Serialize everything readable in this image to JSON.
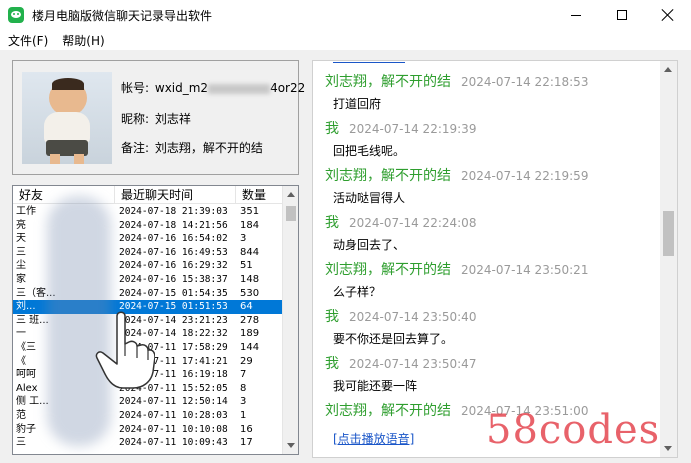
{
  "window": {
    "title": "楼月电脑版微信聊天记录导出软件",
    "controls": [
      "minimize",
      "maximize",
      "close"
    ]
  },
  "menu": [
    "文件(F)",
    "帮助(H)"
  ],
  "profile": {
    "account_label": "帐号:",
    "account_prefix": "wxid_m2",
    "account_suffix": "4or22",
    "nickname_label": "昵称:",
    "nickname": "刘志祥",
    "note_label": "备注:",
    "note": "刘志翔，解不开的结"
  },
  "friends": {
    "headers": [
      "好友",
      "最近聊天时间",
      "数量"
    ],
    "rows": [
      {
        "name": "工作",
        "time": "2024-07-18 21:39:03",
        "count": "351"
      },
      {
        "name": "亮",
        "time": "2024-07-18 14:21:56",
        "count": "184"
      },
      {
        "name": "天",
        "time": "2024-07-16 16:54:02",
        "count": "3"
      },
      {
        "name": "三",
        "time": "2024-07-16 16:49:53",
        "count": "844"
      },
      {
        "name": "尘",
        "time": "2024-07-16 16:29:32",
        "count": "51"
      },
      {
        "name": "家",
        "time": "2024-07-16 15:38:37",
        "count": "148"
      },
      {
        "name": "三（客...",
        "time": "2024-07-15 01:54:35",
        "count": "530"
      },
      {
        "name": "刘...",
        "time": "2024-07-15 01:51:53",
        "count": "64",
        "selected": true
      },
      {
        "name": "三 班...",
        "time": "2024-07-14 23:21:23",
        "count": "278"
      },
      {
        "name": "一",
        "time": "2024-07-14 18:22:32",
        "count": "189"
      },
      {
        "name": "《三",
        "time": "2024-07-11 17:58:29",
        "count": "144"
      },
      {
        "name": "《",
        "time": "2024-07-11 17:41:21",
        "count": "29"
      },
      {
        "name": "呵呵",
        "time": "2024-07-11 16:19:18",
        "count": "7"
      },
      {
        "name": "Alex",
        "time": "2024-07-11 15:52:05",
        "count": "8"
      },
      {
        "name": "侧 工...",
        "time": "2024-07-11 12:50:14",
        "count": "3"
      },
      {
        "name": "范",
        "time": "2024-07-11 10:28:03",
        "count": "1"
      },
      {
        "name": "豹子",
        "time": "2024-07-11 10:10:08",
        "count": "16"
      },
      {
        "name": "三",
        "time": "2024-07-11 10:09:43",
        "count": "17"
      }
    ]
  },
  "chat": {
    "messages": [
      {
        "sender": "刘志翔，解不开的结",
        "time": "2024-07-14 22:18:53",
        "text": "打道回府"
      },
      {
        "sender": "我",
        "time": "2024-07-14 22:19:39",
        "text": "回把毛线呢。"
      },
      {
        "sender": "刘志翔，解不开的结",
        "time": "2024-07-14 22:19:59",
        "text": "活动哒冒得人"
      },
      {
        "sender": "我",
        "time": "2024-07-14 22:24:08",
        "text": "动身回去了、"
      },
      {
        "sender": "刘志翔，解不开的结",
        "time": "2024-07-14 23:50:21",
        "text": "么子样？"
      },
      {
        "sender": "我",
        "time": "2024-07-14 23:50:40",
        "text": "要不你还是回去算了。"
      },
      {
        "sender": "我",
        "time": "2024-07-14 23:50:47",
        "text": "我可能还要一阵"
      },
      {
        "sender": "刘志翔，解不开的结",
        "time": "2024-07-14 23:51:00",
        "text": ""
      }
    ],
    "voice_link": "[点击播放语音]"
  },
  "watermark": "58codes",
  "colors": {
    "sender_green": "#2e9e2e",
    "time_gray": "#9a9a9a",
    "selection_blue": "#0078d7",
    "link_blue": "#1a56c8",
    "watermark_red": "#e44650"
  }
}
